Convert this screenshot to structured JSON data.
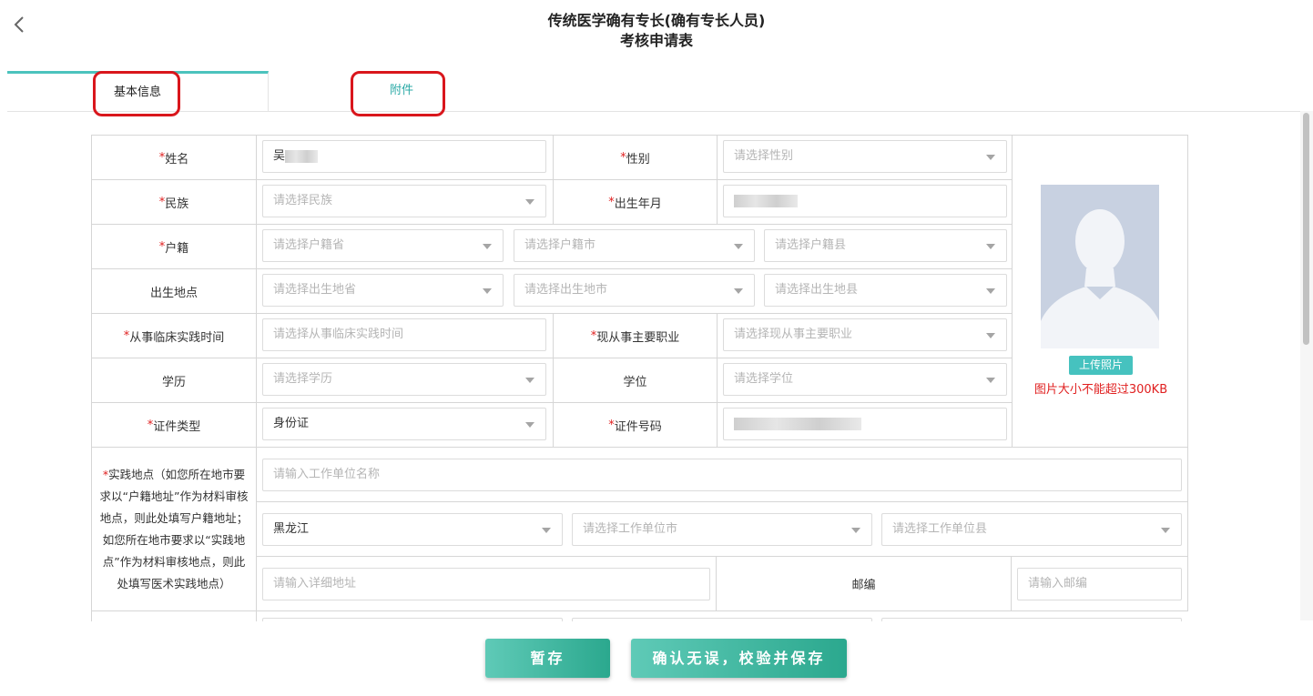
{
  "header": {
    "title_line1": "传统医学确有专长(确有专长人员)",
    "title_line2": "考核申请表"
  },
  "tabs": [
    {
      "label": "基本信息",
      "active": true
    },
    {
      "label": "附件",
      "active": false
    }
  ],
  "form": {
    "name": {
      "label": "姓名",
      "required": true,
      "value": "吴"
    },
    "gender": {
      "label": "性别",
      "required": true,
      "placeholder": "请选择性别"
    },
    "ethnicity": {
      "label": "民族",
      "required": true,
      "placeholder": "请选择民族"
    },
    "birth_date": {
      "label": "出生年月",
      "required": true
    },
    "household": {
      "label": "户籍",
      "required": true,
      "province_placeholder": "请选择户籍省",
      "city_placeholder": "请选择户籍市",
      "county_placeholder": "请选择户籍县"
    },
    "birthplace": {
      "label": "出生地点",
      "required": false,
      "province_placeholder": "请选择出生地省",
      "city_placeholder": "请选择出生地市",
      "county_placeholder": "请选择出生地县"
    },
    "practice_time": {
      "label": "从事临床实践时间",
      "required": true,
      "placeholder": "请选择从事临床实践时间"
    },
    "occupation": {
      "label": "现从事主要职业",
      "required": true,
      "placeholder": "请选择现从事主要职业"
    },
    "education": {
      "label": "学历",
      "required": false,
      "placeholder": "请选择学历"
    },
    "degree": {
      "label": "学位",
      "required": false,
      "placeholder": "请选择学位"
    },
    "id_type": {
      "label": "证件类型",
      "required": true,
      "value": "身份证"
    },
    "id_number": {
      "label": "证件号码",
      "required": true
    },
    "practice_location": {
      "label": "实践地点（如您所在地市要求以“户籍地址”作为材料审核地点，则此处填写户籍地址；如您所在地市要求以“实践地点”作为材料审核地点，则此处填写医术实践地点）",
      "required": true,
      "unit_placeholder": "请输入工作单位名称",
      "province_value": "黑龙江",
      "city_placeholder": "请选择工作单位市",
      "county_placeholder": "请选择工作单位县",
      "address_placeholder": "请输入详细地址",
      "postcode_label": "邮编",
      "postcode_placeholder": "请输入邮编"
    }
  },
  "photo": {
    "upload_label": "上传照片",
    "note": "图片大小不能超过300KB"
  },
  "actions": {
    "save_draft": "暂存",
    "confirm_save": "确认无误，校验并保存"
  },
  "colors": {
    "accent": "#4cc3bd",
    "required": "#e02020",
    "highlight": "#d9161c"
  }
}
